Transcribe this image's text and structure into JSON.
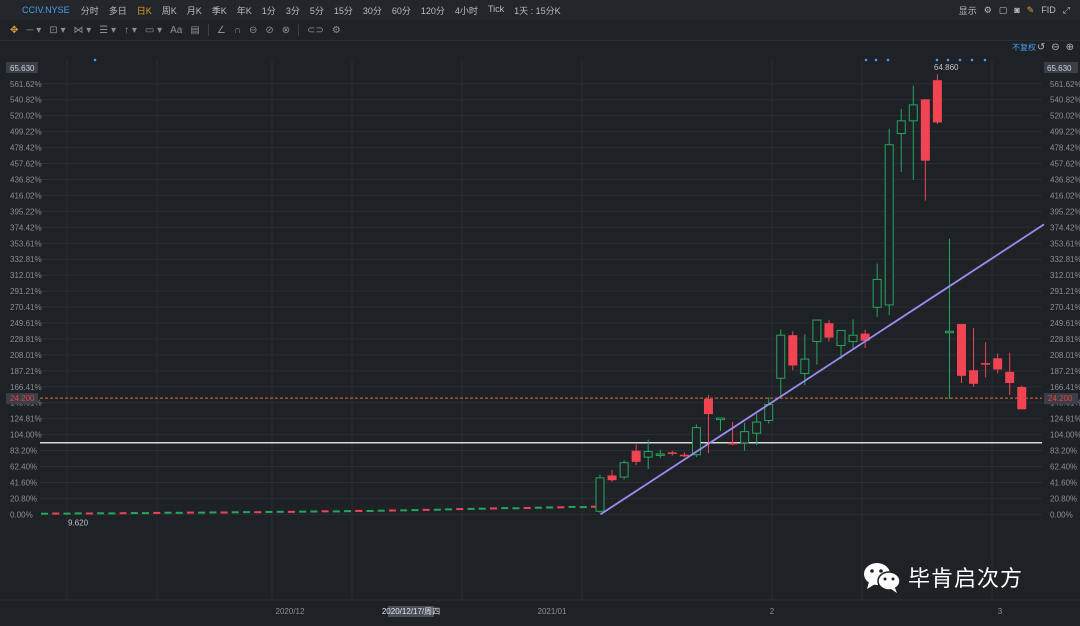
{
  "toolbar": {
    "symbol": "CCIV.NYSE",
    "timeframes": [
      "分时",
      "多日",
      "日K",
      "周K",
      "月K",
      "季K",
      "年K",
      "1分",
      "3分",
      "5分",
      "15分",
      "30分",
      "60分",
      "120分",
      "4小时",
      "Tick"
    ],
    "active_timeframe": "日K",
    "range_label": "1天 : 15分K",
    "display_label": "显示",
    "fid_label": "FID"
  },
  "chart_controls": {
    "adjust_label": "不复权"
  },
  "brand": {
    "text": "毕肯启次方"
  },
  "colors": {
    "up": "#26a65b",
    "down": "#f04452",
    "trend": "#9b8cf0",
    "support": "#d8d8d8",
    "price_line": "#e0703a"
  },
  "chart_data": {
    "type": "candlestick",
    "y_axis": {
      "top_label": "65.630",
      "tick_labels": [
        "561.62%",
        "540.82%",
        "520.02%",
        "499.22%",
        "478.42%",
        "457.62%",
        "436.82%",
        "416.02%",
        "395.22%",
        "374.42%",
        "353.61%",
        "332.81%",
        "312.01%",
        "291.21%",
        "270.41%",
        "249.61%",
        "228.81%",
        "208.01%",
        "187.21%",
        "166.41%",
        "145.61%",
        "124.81%",
        "104.00%",
        "83.20%",
        "62.40%",
        "41.60%",
        "20.80%",
        "0.00%"
      ],
      "range": [
        0,
        65.63
      ],
      "current_price": "24.200"
    },
    "x_axis": {
      "tick_labels": [
        "2020/12",
        "2020/12/17/周四",
        "2021/01",
        "2",
        "3"
      ],
      "highlighted": "2020/12/17/周四"
    },
    "annotations": {
      "high": "64.860",
      "low": "9.620"
    },
    "support_line": 18.6,
    "trend_line": {
      "from": [
        "2021/01/11",
        9.62
      ],
      "to": [
        "2021/03/05",
        46.0
      ]
    },
    "flat_candles": [
      9.7,
      9.72,
      9.71,
      9.74,
      9.73,
      9.75,
      9.74,
      9.76,
      9.78,
      9.77,
      9.8,
      9.82,
      9.81,
      9.84,
      9.83,
      9.86,
      9.85,
      9.88,
      9.9,
      9.89,
      9.92,
      9.94,
      9.93,
      9.96,
      9.98,
      10.0,
      9.99,
      10.02,
      10.05,
      10.04,
      10.08,
      10.1,
      10.12,
      10.15,
      10.18,
      10.2,
      10.24,
      10.28,
      10.3,
      10.33,
      10.36,
      10.4,
      10.38,
      10.42,
      10.45,
      10.48,
      10.5,
      10.55,
      10.53,
      10.58
    ],
    "candles": [
      {
        "o": 10.0,
        "h": 14.6,
        "l": 9.8,
        "c": 14.2
      },
      {
        "o": 14.5,
        "h": 15.2,
        "l": 13.7,
        "c": 13.9
      },
      {
        "o": 14.3,
        "h": 16.4,
        "l": 14.0,
        "c": 16.1
      },
      {
        "o": 17.6,
        "h": 18.4,
        "l": 15.8,
        "c": 16.2
      },
      {
        "o": 16.8,
        "h": 19.0,
        "l": 15.3,
        "c": 17.5
      },
      {
        "o": 17.1,
        "h": 17.7,
        "l": 16.7,
        "c": 17.2
      },
      {
        "o": 17.4,
        "h": 17.6,
        "l": 17.0,
        "c": 17.2
      },
      {
        "o": 17.1,
        "h": 17.4,
        "l": 16.8,
        "c": 16.9
      },
      {
        "o": 17.1,
        "h": 20.9,
        "l": 16.8,
        "c": 20.5
      },
      {
        "o": 24.1,
        "h": 24.6,
        "l": 17.3,
        "c": 22.2
      },
      {
        "o": 21.5,
        "h": 21.7,
        "l": 20.1,
        "c": 21.7
      },
      {
        "o": 18.6,
        "h": 21.2,
        "l": 18.3,
        "c": 18.4
      },
      {
        "o": 18.6,
        "h": 21.1,
        "l": 17.6,
        "c": 20.0
      },
      {
        "o": 19.8,
        "h": 22.2,
        "l": 18.3,
        "c": 21.2
      },
      {
        "o": 21.4,
        "h": 24.3,
        "l": 21.0,
        "c": 23.4
      },
      {
        "o": 26.7,
        "h": 32.8,
        "l": 24.3,
        "c": 32.1
      },
      {
        "o": 32.1,
        "h": 32.6,
        "l": 27.7,
        "c": 28.3
      },
      {
        "o": 27.3,
        "h": 32.2,
        "l": 25.8,
        "c": 29.1
      },
      {
        "o": 31.3,
        "h": 34.0,
        "l": 28.4,
        "c": 34.0
      },
      {
        "o": 33.6,
        "h": 34.0,
        "l": 31.3,
        "c": 31.8
      },
      {
        "o": 30.8,
        "h": 32.5,
        "l": 29.1,
        "c": 32.7
      },
      {
        "o": 31.3,
        "h": 34.1,
        "l": 30.4,
        "c": 32.1
      },
      {
        "o": 32.3,
        "h": 32.8,
        "l": 30.5,
        "c": 31.4
      },
      {
        "o": 35.6,
        "h": 41.1,
        "l": 34.4,
        "c": 39.1
      },
      {
        "o": 35.9,
        "h": 58.0,
        "l": 34.6,
        "c": 56.0
      },
      {
        "o": 57.4,
        "h": 60.5,
        "l": 52.6,
        "c": 59.0
      },
      {
        "o": 59.0,
        "h": 63.4,
        "l": 51.6,
        "c": 61.0
      },
      {
        "o": 61.7,
        "h": 61.7,
        "l": 49.0,
        "c": 54.0
      },
      {
        "o": 64.1,
        "h": 64.86,
        "l": 58.6,
        "c": 58.8
      },
      {
        "o": 32.6,
        "h": 44.2,
        "l": 24.1,
        "c": 32.6
      },
      {
        "o": 33.5,
        "h": 33.5,
        "l": 26.1,
        "c": 27.0
      },
      {
        "o": 27.7,
        "h": 33.0,
        "l": 25.6,
        "c": 26.0
      },
      {
        "o": 28.6,
        "h": 31.2,
        "l": 26.8,
        "c": 28.4
      },
      {
        "o": 29.2,
        "h": 29.8,
        "l": 27.3,
        "c": 27.8
      },
      {
        "o": 27.5,
        "h": 29.9,
        "l": 24.6,
        "c": 26.1
      },
      {
        "o": 25.6,
        "h": 25.8,
        "l": 22.8,
        "c": 22.8
      }
    ]
  }
}
